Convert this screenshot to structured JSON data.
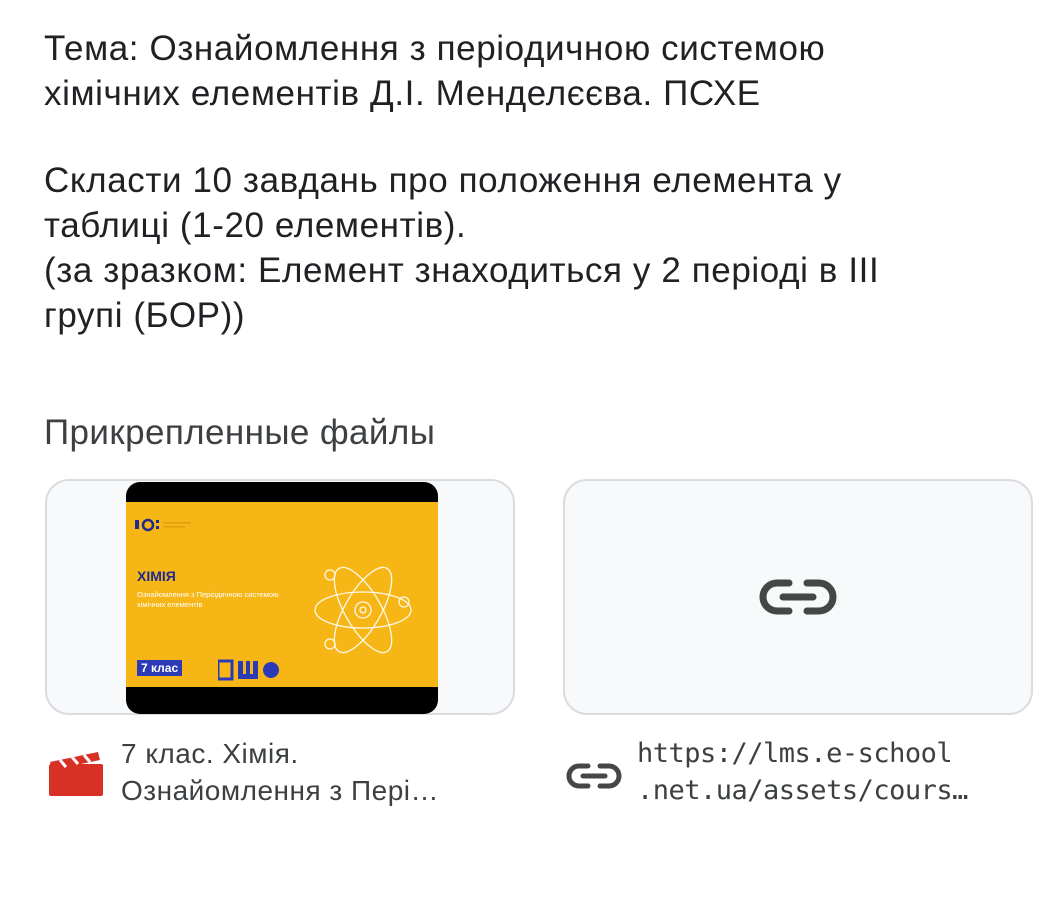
{
  "assignment": {
    "topic": "Тема: Ознайомлення з періодичною системою\nхімічних елементів Д.І. Менделєєва. ПСХЕ",
    "task": "Скласти 10 завдань про положення елемента у\nтаблиці (1-20 елементів).\n(за зразком: Елемент знаходиться у 2 періоді в III\nгрупі (БОР))"
  },
  "attachments": {
    "title": "Прикрепленные файлы",
    "video": {
      "icon": "video-clapper-icon",
      "caption_line1": "7 клас. Хімія.",
      "caption_line2": "Ознайомлення з Пері…",
      "thumbnail": {
        "subject": "ХІМІЯ",
        "subtitle": "Ознайомлення з Періодичною системою хімічних елементів",
        "grade": "7 клас",
        "accent": "#f6b616"
      }
    },
    "link": {
      "icon": "link-icon",
      "caption_line1": "https://lms.e-school",
      "caption_line2": ".net.ua/assets/cours…"
    }
  },
  "colors": {
    "text": "#202124",
    "card_border": "#dadce0",
    "card_bg": "#f8f9fa",
    "video_icon": "#d93025"
  }
}
